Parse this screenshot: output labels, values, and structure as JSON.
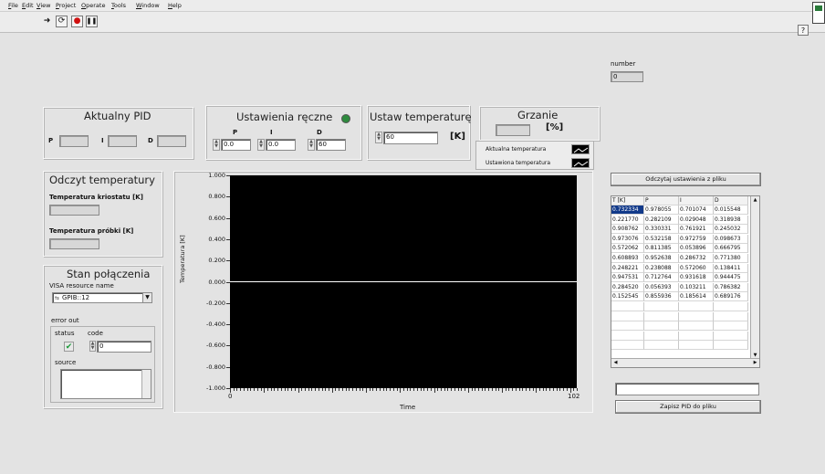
{
  "menu": [
    "File",
    "Edit",
    "View",
    "Project",
    "Operate",
    "Tools",
    "Window",
    "Help"
  ],
  "toolbar": {
    "run_icon": "run-arrow-icon",
    "continuous_icon": "run-continuous-icon",
    "abort_icon": "abort-icon",
    "pause_icon": "pause-icon",
    "help_icon": "help-icon"
  },
  "number": {
    "label": "number",
    "value": "0"
  },
  "pid_current": {
    "title": "Aktualny PID",
    "p_label": "P",
    "i_label": "I",
    "d_label": "D"
  },
  "pid_manual": {
    "title": "Ustawienia ręczne",
    "p_label": "P",
    "i_label": "I",
    "d_label": "D",
    "p_value": "0.0",
    "i_value": "0.0",
    "d_value": "60",
    "led_color": "#2e8b3e"
  },
  "set_temperature": {
    "title": "Ustaw temperaturę",
    "value": "60",
    "unit": "[K]"
  },
  "heating": {
    "title": "Grzanie",
    "unit": "[%]"
  },
  "temp_readout": {
    "title": "Odczyt temperatury",
    "cryostat_label": "Temperatura kriostatu [K]",
    "sample_label": "Temperatura próbki [K]"
  },
  "connection": {
    "title": "Stan połączenia",
    "visa_label": "VISA resource name",
    "visa_value": "GPIB::12",
    "error_label": "error out",
    "status_label": "status",
    "code_label": "code",
    "code_value": "0",
    "source_label": "source"
  },
  "legend": {
    "items": [
      {
        "label": "Aktualna temperatura"
      },
      {
        "label": "Ustawiona temperatura"
      }
    ]
  },
  "chart_data": {
    "type": "line",
    "ylabel": "Temperatura [K]",
    "xlabel": "Time",
    "yticks": [
      "1.000",
      "0.800",
      "0.600",
      "0.400",
      "0.200",
      "0.000",
      "-0.200",
      "-0.400",
      "-0.600",
      "-0.800",
      "-1.000"
    ],
    "xticks": [
      "0",
      "102"
    ],
    "xlim": [
      0,
      102
    ],
    "ylim": [
      -1,
      1
    ],
    "series": [
      {
        "name": "Aktualna temperatura",
        "x": [
          0,
          102
        ],
        "y": [
          0,
          0
        ],
        "color": "#ffffff"
      }
    ]
  },
  "file_read_button": "Odczytaj ustawienia z pliku",
  "file_save_button": "Zapisz PID do pliku",
  "table": {
    "headers": [
      "T [K]",
      "P",
      "I",
      "D"
    ],
    "rows": [
      [
        "0.732334",
        "0.978055",
        "0.701074",
        "0.015548"
      ],
      [
        "0.221770",
        "0.282109",
        "0.029048",
        "0.318938"
      ],
      [
        "0.908762",
        "0.330331",
        "0.761921",
        "0.245032"
      ],
      [
        "0.973076",
        "0.532158",
        "0.972759",
        "0.098673"
      ],
      [
        "0.572062",
        "0.811385",
        "0.053896",
        "0.666795"
      ],
      [
        "0.608893",
        "0.952638",
        "0.286732",
        "0.771380"
      ],
      [
        "0.248221",
        "0.238088",
        "0.572060",
        "0.138411"
      ],
      [
        "0.947531",
        "0.712764",
        "0.931618",
        "0.944475"
      ],
      [
        "0.284520",
        "0.056393",
        "0.103211",
        "0.786382"
      ],
      [
        "0.152545",
        "0.855936",
        "0.185614",
        "0.689176"
      ]
    ]
  }
}
